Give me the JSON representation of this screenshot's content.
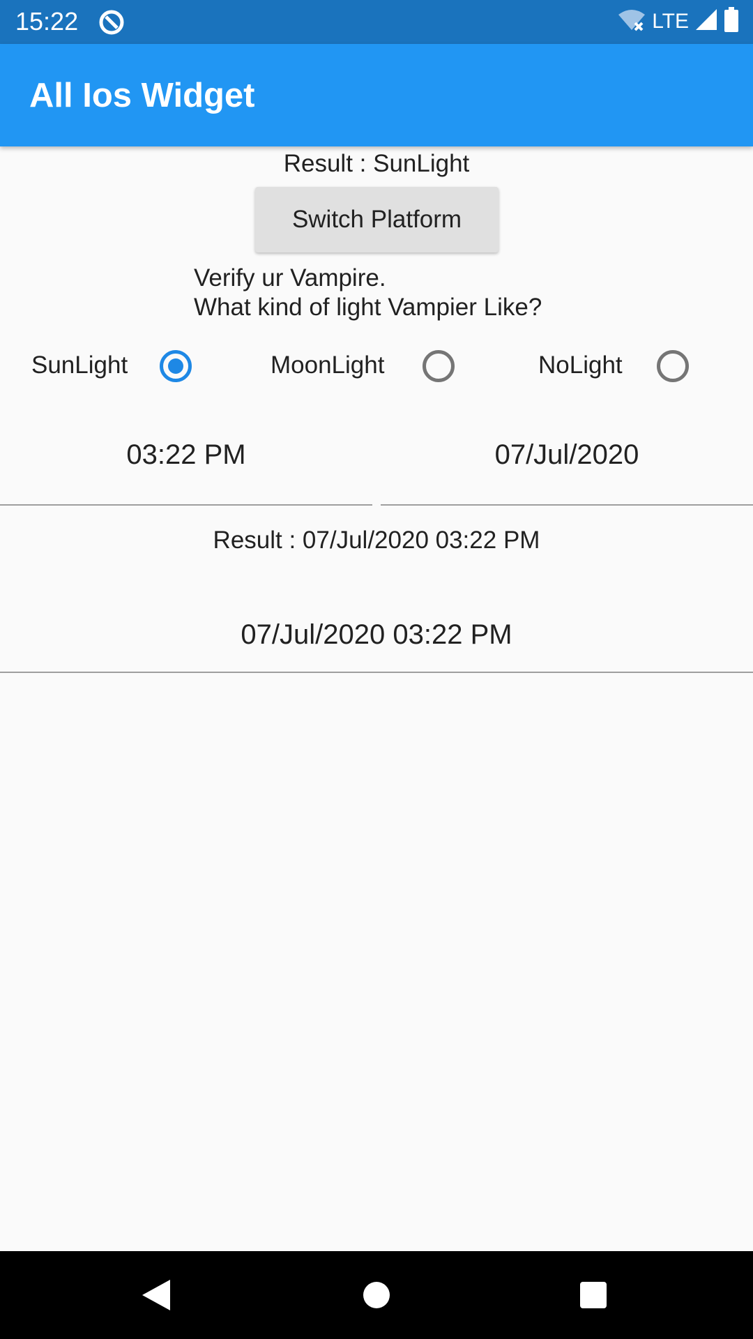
{
  "status_bar": {
    "time": "15:22",
    "network": "LTE"
  },
  "app_bar": {
    "title": "All Ios Widget"
  },
  "radio_result": "Result : SunLight",
  "switch_button_label": "Switch Platform",
  "question": {
    "line1": "Verify ur Vampire.",
    "line2": "What kind of light Vampier Like?"
  },
  "radio_options": [
    {
      "label": "SunLight",
      "selected": true
    },
    {
      "label": "MoonLight",
      "selected": false
    },
    {
      "label": "NoLight",
      "selected": false
    }
  ],
  "time_value": "03:22 PM",
  "date_value": "07/Jul/2020",
  "datetime_result": "Result : 07/Jul/2020 03:22 PM",
  "datetime_value": "07/Jul/2020 03:22 PM",
  "colors": {
    "status_bar": "#1a73bd",
    "app_bar": "#2196f3",
    "radio_selected": "#1e88e5"
  }
}
